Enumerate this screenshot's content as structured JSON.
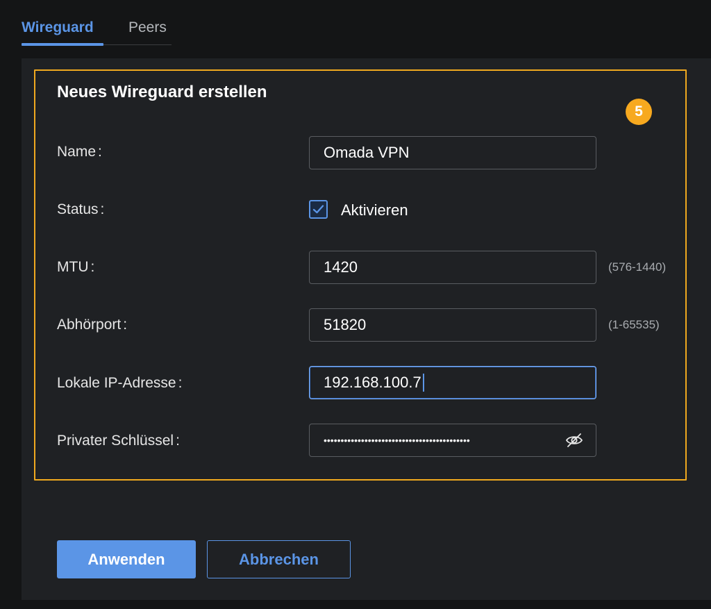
{
  "tabs": {
    "wireguard": "Wireguard",
    "peers": "Peers"
  },
  "form": {
    "title": "Neues Wireguard erstellen",
    "step_badge": "5",
    "fields": {
      "name": {
        "label": "Name",
        "value": "Omada VPN"
      },
      "status": {
        "label": "Status",
        "checkbox_label": "Aktivieren",
        "checked": true
      },
      "mtu": {
        "label": "MTU",
        "value": "1420",
        "hint": "(576-1440)"
      },
      "listen_port": {
        "label": "Abhörport",
        "value": "51820",
        "hint": "(1-65535)"
      },
      "local_ip": {
        "label": "Lokale IP-Adresse",
        "value": "192.168.100.7"
      },
      "private_key": {
        "label": "Privater Schlüssel",
        "value": "•••••••••••••••••••••••••••••••••••••••••••"
      }
    },
    "colon": ":"
  },
  "buttons": {
    "apply": "Anwenden",
    "cancel": "Abbrechen"
  },
  "colors": {
    "accent": "#5b95e6",
    "highlight": "#f0a91f",
    "panel": "#1f2124",
    "background": "#141516"
  },
  "icons": {
    "checkbox": "checkmark-icon",
    "password_toggle": "eye-off-icon"
  }
}
